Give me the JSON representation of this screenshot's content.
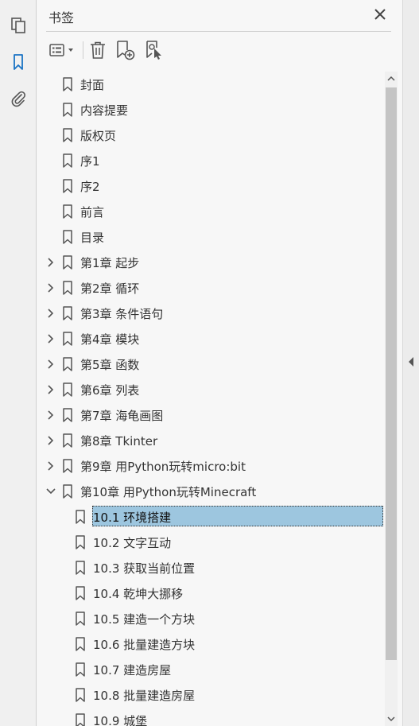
{
  "panel": {
    "title": "书签"
  },
  "icons": {
    "pages": "pages-icon",
    "bookmarks": "bookmark-icon",
    "attachments": "paperclip-icon",
    "close": "close-icon",
    "options": "list-options-icon",
    "delete": "trash-icon",
    "new_bookmark": "add-bookmark-icon",
    "bookmark_from_selection": "bookmark-selection-icon"
  },
  "colors": {
    "accent": "#1a73c4",
    "selection": "#9dc6df"
  },
  "bookmarks": [
    {
      "label": "封面",
      "level": 0,
      "expander": "none"
    },
    {
      "label": "内容提要",
      "level": 0,
      "expander": "none"
    },
    {
      "label": "版权页",
      "level": 0,
      "expander": "none"
    },
    {
      "label": "序1",
      "level": 0,
      "expander": "none"
    },
    {
      "label": "序2",
      "level": 0,
      "expander": "none"
    },
    {
      "label": "前言",
      "level": 0,
      "expander": "none"
    },
    {
      "label": "目录",
      "level": 0,
      "expander": "none"
    },
    {
      "label": "第1章 起步",
      "level": 0,
      "expander": "collapsed"
    },
    {
      "label": "第2章 循环",
      "level": 0,
      "expander": "collapsed"
    },
    {
      "label": "第3章 条件语句",
      "level": 0,
      "expander": "collapsed"
    },
    {
      "label": "第4章 模块",
      "level": 0,
      "expander": "collapsed"
    },
    {
      "label": "第5章 函数",
      "level": 0,
      "expander": "collapsed"
    },
    {
      "label": "第6章 列表",
      "level": 0,
      "expander": "collapsed"
    },
    {
      "label": "第7章 海龟画图",
      "level": 0,
      "expander": "collapsed"
    },
    {
      "label": "第8章 Tkinter",
      "level": 0,
      "expander": "collapsed"
    },
    {
      "label": "第9章 用Python玩转micro:bit",
      "level": 0,
      "expander": "collapsed"
    },
    {
      "label": "第10章 用Python玩转Minecraft",
      "level": 0,
      "expander": "expanded"
    },
    {
      "label": "10.1 环境搭建",
      "level": 1,
      "expander": "none",
      "selected": true
    },
    {
      "label": "10.2 文字互动",
      "level": 1,
      "expander": "none"
    },
    {
      "label": "10.3 获取当前位置",
      "level": 1,
      "expander": "none"
    },
    {
      "label": "10.4 乾坤大挪移",
      "level": 1,
      "expander": "none"
    },
    {
      "label": "10.5 建造一个方块",
      "level": 1,
      "expander": "none"
    },
    {
      "label": "10.6 批量建造方块",
      "level": 1,
      "expander": "none"
    },
    {
      "label": "10.7 建造房屋",
      "level": 1,
      "expander": "none"
    },
    {
      "label": "10.8 批量建造房屋",
      "level": 1,
      "expander": "none"
    },
    {
      "label": "10.9 城堡",
      "level": 1,
      "expander": "none"
    }
  ]
}
